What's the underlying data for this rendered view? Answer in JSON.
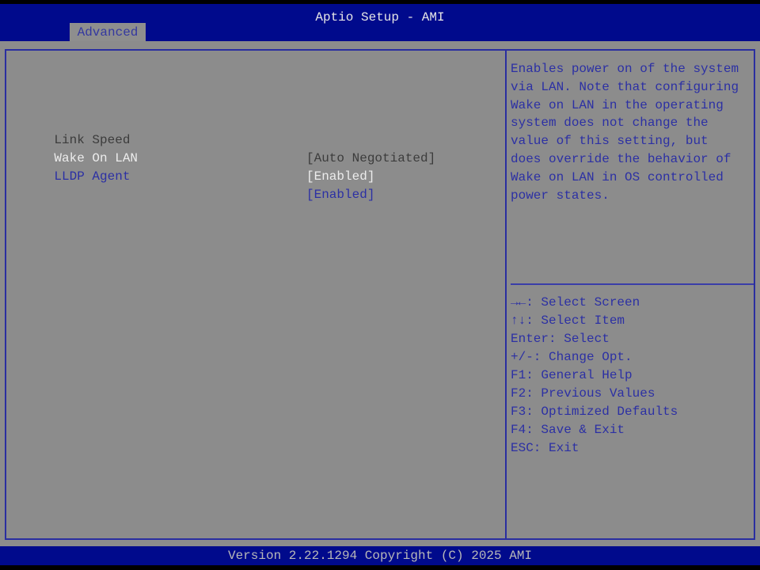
{
  "header": {
    "title": "Aptio Setup - AMI",
    "tabs": [
      {
        "label": "Advanced"
      }
    ]
  },
  "settings": [
    {
      "label": "Link Speed",
      "value": "[Auto Negotiated]",
      "state": "readonly"
    },
    {
      "label": "Wake On LAN",
      "value": "[Enabled]",
      "state": "selected"
    },
    {
      "label": "LLDP Agent",
      "value": "[Enabled]",
      "state": "normal"
    }
  ],
  "help": {
    "text": "Enables power on of the system\nvia LAN. Note that configuring\nWake on LAN in the operating\nsystem does not change the\nvalue of this setting, but\ndoes override the behavior of\nWake on LAN in OS controlled\npower states."
  },
  "keys": [
    {
      "key": "→←:",
      "desc": " Select Screen"
    },
    {
      "key": "↑↓:",
      "desc": " Select Item"
    },
    {
      "key": "Enter:",
      "desc": " Select"
    },
    {
      "key": "+/-:",
      "desc": " Change Opt."
    },
    {
      "key": "F1:",
      "desc": " General Help"
    },
    {
      "key": "F2:",
      "desc": " Previous Values"
    },
    {
      "key": "F3:",
      "desc": " Optimized Defaults"
    },
    {
      "key": "F4:",
      "desc": " Save & Exit"
    },
    {
      "key": "ESC:",
      "desc": " Exit"
    }
  ],
  "footer": {
    "text": "Version 2.22.1294 Copyright (C) 2025 AMI"
  },
  "colors": {
    "blue": "#000a8c",
    "gray": "#8c8c8c",
    "text_blue": "#2c30a4"
  }
}
